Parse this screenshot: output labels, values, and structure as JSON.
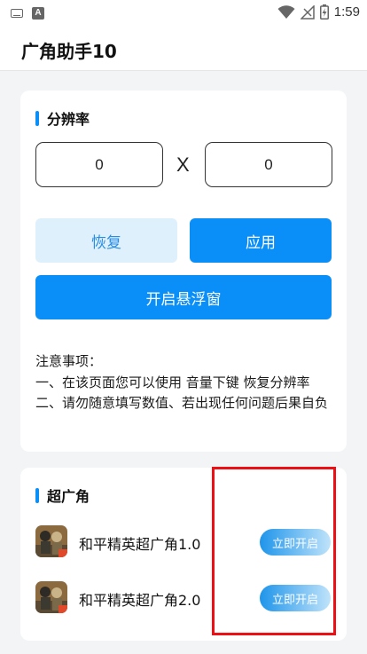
{
  "status_bar": {
    "time": "1:59",
    "left_icons": [
      "keyboard-icon",
      "a-icon"
    ],
    "right_icons": [
      "wifi-icon",
      "signal-icon",
      "battery-charging-icon"
    ],
    "a_icon_text": "A"
  },
  "app_bar": {
    "title": "广角助手10"
  },
  "resolution": {
    "title": "分辨率",
    "width_value": "0",
    "height_value": "0",
    "separator": "X",
    "restore_label": "恢复",
    "apply_label": "应用",
    "float_label": "开启悬浮窗",
    "notes": [
      "注意事项：",
      "一、在该页面您可以使用 音量下键 恢复分辨率",
      "二、请勿随意填写数值、若出现任何问题后果自负"
    ]
  },
  "super_wide": {
    "title": "超广角",
    "items": [
      {
        "name": "和平精英超广角1.0",
        "button": "立即开启"
      },
      {
        "name": "和平精英超广角2.0",
        "button": "立即开启"
      }
    ]
  },
  "colors": {
    "accent": "#0a8ef7",
    "accent_light": "#dff0fd",
    "highlight": "#ee0f14"
  }
}
